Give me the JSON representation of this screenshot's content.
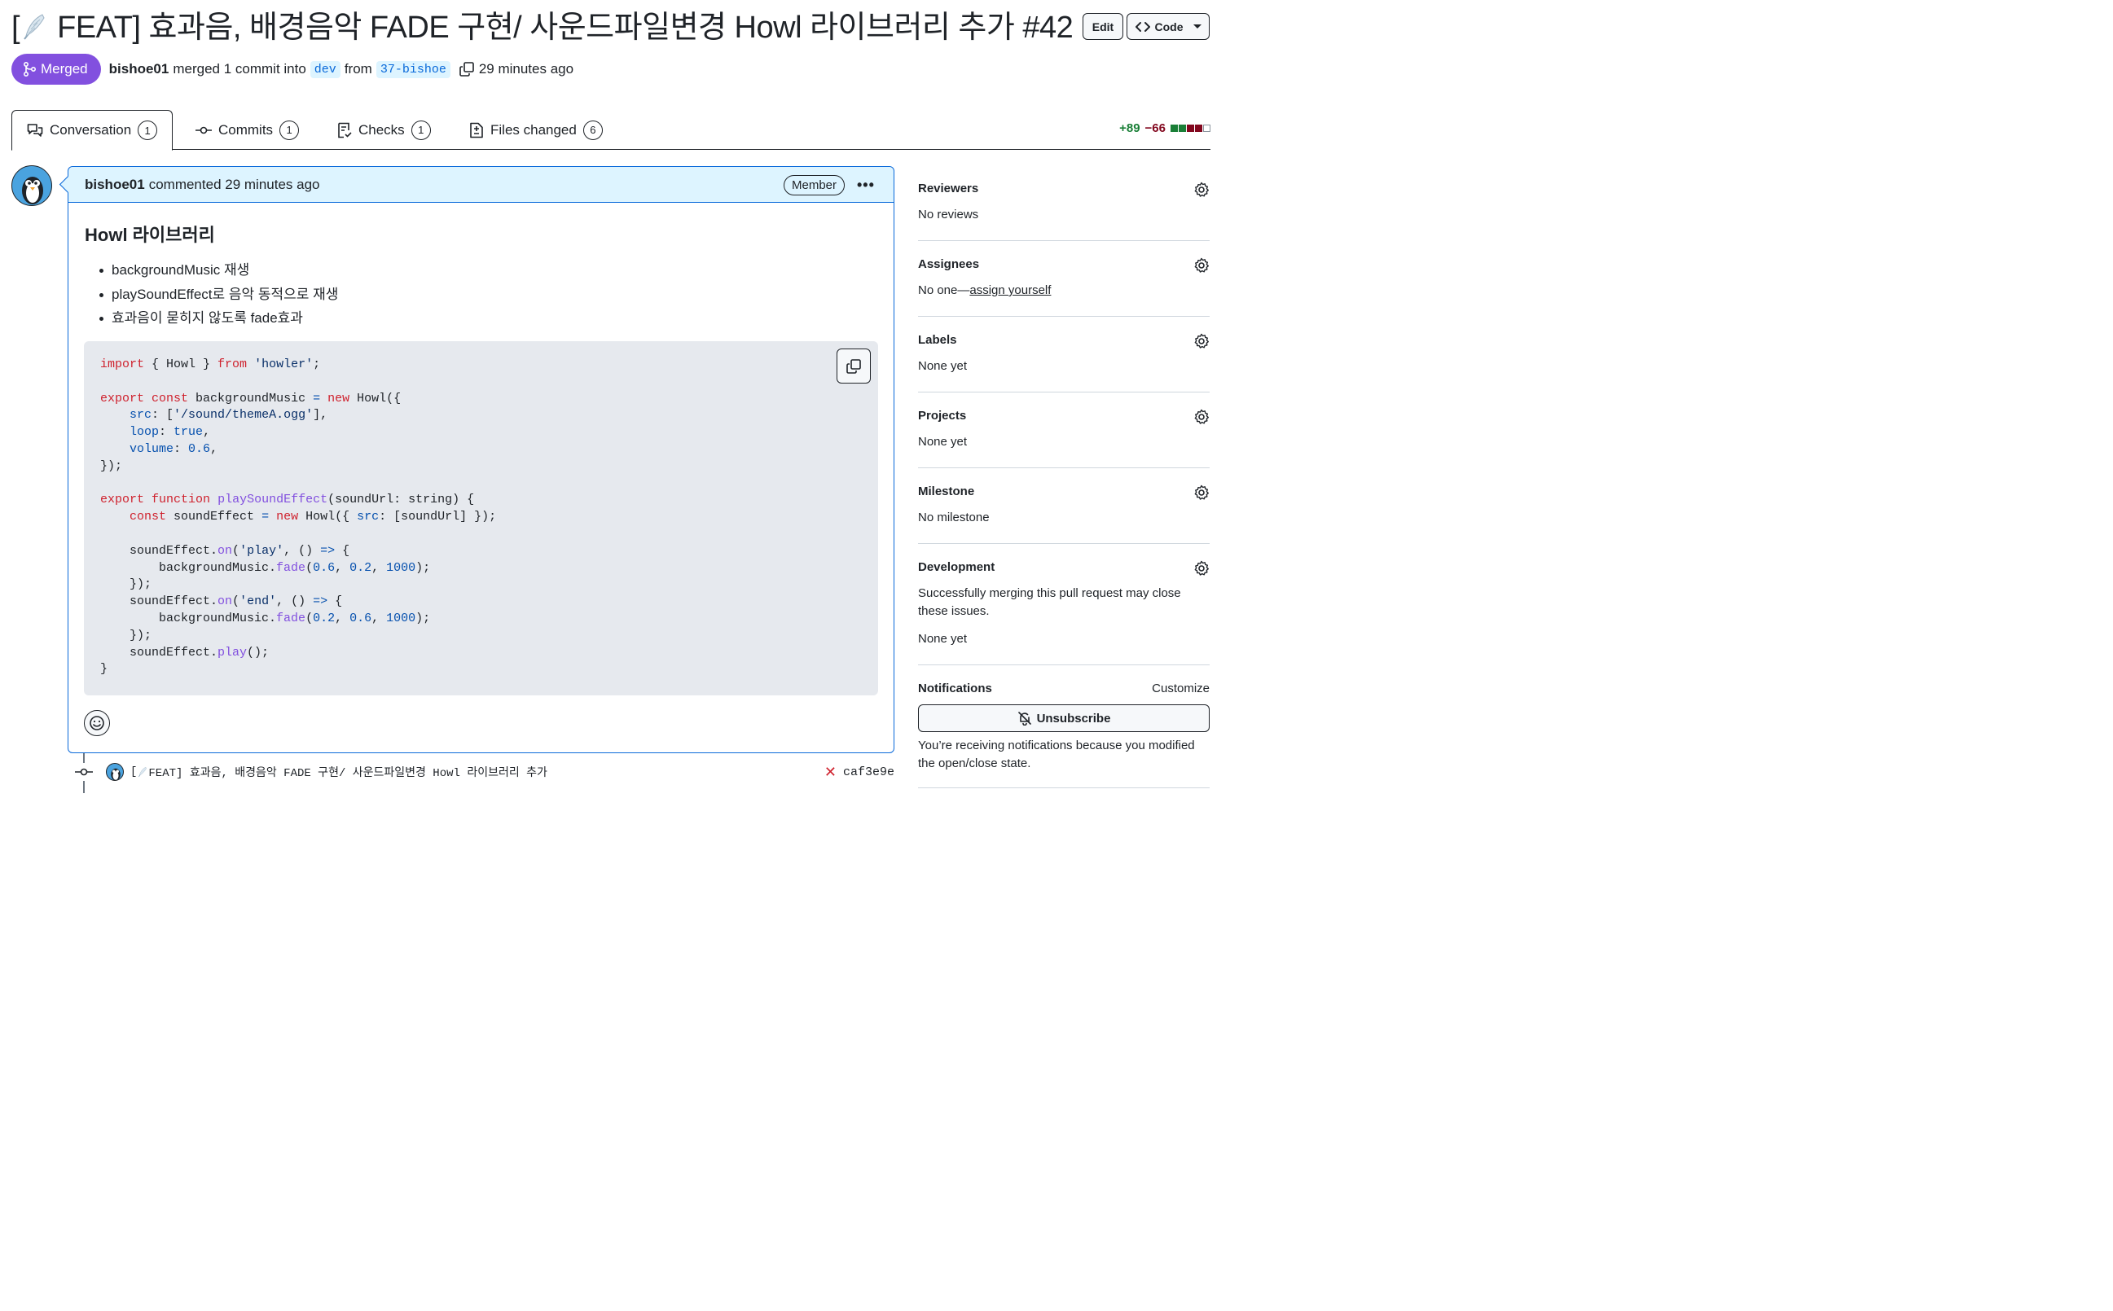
{
  "header": {
    "title_prefix": "[",
    "title_text": " FEAT] 효과음, 배경음악 FADE 구현/ 사운드파일변경 Howl 라이브러리 추가 #42",
    "edit_label": "Edit",
    "code_label": "Code"
  },
  "meta": {
    "status_label": "Merged",
    "author": "bishoe01",
    "merged_text": "merged 1 commit into",
    "base_branch": "dev",
    "from_text": "from",
    "head_branch": "37-bishoe",
    "time": "29 minutes ago"
  },
  "tabs": [
    {
      "label": "Conversation",
      "count": "1",
      "icon": "comment-discussion-icon"
    },
    {
      "label": "Commits",
      "count": "1",
      "icon": "git-commit-icon"
    },
    {
      "label": "Checks",
      "count": "1",
      "icon": "checklist-icon"
    },
    {
      "label": "Files changed",
      "count": "6",
      "icon": "file-diff-icon"
    }
  ],
  "diffstat": {
    "additions": "+89",
    "deletions": "−66",
    "blocks": [
      "#1a7f37",
      "#1a7f37",
      "#82071e",
      "#82071e",
      "#ffffff"
    ]
  },
  "comment": {
    "author": "bishoe01",
    "action": "commented 29 minutes ago",
    "role_badge": "Member",
    "heading": "Howl 라이브러리",
    "bullets": [
      "backgroundMusic 재생",
      "playSoundEffect로 음악 동적으로 재생",
      "효과음이 묻히지 않도록 fade효과"
    ],
    "code": [
      [
        [
          "k",
          "import"
        ],
        [
          "p",
          " { Howl } "
        ],
        [
          "k",
          "from"
        ],
        [
          "p",
          " "
        ],
        [
          "s",
          "'howler'"
        ],
        [
          "p",
          ";"
        ]
      ],
      [],
      [
        [
          "k",
          "export"
        ],
        [
          "p",
          " "
        ],
        [
          "k",
          "const"
        ],
        [
          "p",
          " backgroundMusic "
        ],
        [
          "c",
          "="
        ],
        [
          "p",
          " "
        ],
        [
          "k",
          "new"
        ],
        [
          "p",
          " Howl({"
        ]
      ],
      [
        [
          "p",
          "    "
        ],
        [
          "c",
          "src"
        ],
        [
          "p",
          ": ["
        ],
        [
          "s",
          "'/sound/themeA.ogg'"
        ],
        [
          "p",
          "],"
        ]
      ],
      [
        [
          "p",
          "    "
        ],
        [
          "c",
          "loop"
        ],
        [
          "p",
          ": "
        ],
        [
          "c",
          "true"
        ],
        [
          "p",
          ","
        ]
      ],
      [
        [
          "p",
          "    "
        ],
        [
          "c",
          "volume"
        ],
        [
          "p",
          ": "
        ],
        [
          "c",
          "0.6"
        ],
        [
          "p",
          ","
        ]
      ],
      [
        [
          "p",
          "});"
        ]
      ],
      [],
      [
        [
          "k",
          "export"
        ],
        [
          "p",
          " "
        ],
        [
          "k",
          "function"
        ],
        [
          "p",
          " "
        ],
        [
          "f",
          "playSoundEffect"
        ],
        [
          "p",
          "(soundUrl: string) {"
        ]
      ],
      [
        [
          "p",
          "    "
        ],
        [
          "k",
          "const"
        ],
        [
          "p",
          " soundEffect "
        ],
        [
          "c",
          "="
        ],
        [
          "p",
          " "
        ],
        [
          "k",
          "new"
        ],
        [
          "p",
          " Howl({ "
        ],
        [
          "c",
          "src"
        ],
        [
          "p",
          ": [soundUrl] });"
        ]
      ],
      [],
      [
        [
          "p",
          "    soundEffect."
        ],
        [
          "f",
          "on"
        ],
        [
          "p",
          "("
        ],
        [
          "s",
          "'play'"
        ],
        [
          "p",
          ", () "
        ],
        [
          "c",
          "=>"
        ],
        [
          "p",
          " {"
        ]
      ],
      [
        [
          "p",
          "        backgroundMusic."
        ],
        [
          "f",
          "fade"
        ],
        [
          "p",
          "("
        ],
        [
          "c",
          "0.6"
        ],
        [
          "p",
          ", "
        ],
        [
          "c",
          "0.2"
        ],
        [
          "p",
          ", "
        ],
        [
          "c",
          "1000"
        ],
        [
          "p",
          ");"
        ]
      ],
      [
        [
          "p",
          "    });"
        ]
      ],
      [
        [
          "p",
          "    soundEffect."
        ],
        [
          "f",
          "on"
        ],
        [
          "p",
          "("
        ],
        [
          "s",
          "'end'"
        ],
        [
          "p",
          ", () "
        ],
        [
          "c",
          "=>"
        ],
        [
          "p",
          " {"
        ]
      ],
      [
        [
          "p",
          "        backgroundMusic."
        ],
        [
          "f",
          "fade"
        ],
        [
          "p",
          "("
        ],
        [
          "c",
          "0.2"
        ],
        [
          "p",
          ", "
        ],
        [
          "c",
          "0.6"
        ],
        [
          "p",
          ", "
        ],
        [
          "c",
          "1000"
        ],
        [
          "p",
          ");"
        ]
      ],
      [
        [
          "p",
          "    });"
        ]
      ],
      [
        [
          "p",
          "    soundEffect."
        ],
        [
          "f",
          "play"
        ],
        [
          "p",
          "();"
        ]
      ],
      [
        [
          "p",
          "}"
        ]
      ]
    ]
  },
  "commit": {
    "message_prefix": "[",
    "message": " FEAT] 효과음, 배경음악 FADE 구현/ 사운드파일변경 Howl 라이브러리 추가",
    "sha": "caf3e9e",
    "status": "failed"
  },
  "sidebar": {
    "reviewers": {
      "title": "Reviewers",
      "value": "No reviews"
    },
    "assignees": {
      "title": "Assignees",
      "value_prefix": "No one—",
      "link": "assign yourself"
    },
    "labels": {
      "title": "Labels",
      "value": "None yet"
    },
    "projects": {
      "title": "Projects",
      "value": "None yet"
    },
    "milestone": {
      "title": "Milestone",
      "value": "No milestone"
    },
    "development": {
      "title": "Development",
      "note": "Successfully merging this pull request may close these issues.",
      "value": "None yet"
    },
    "notifications": {
      "title": "Notifications",
      "customize": "Customize",
      "unsubscribe": "Unsubscribe",
      "note": "You’re receiving notifications because you modified the open/close state."
    }
  }
}
